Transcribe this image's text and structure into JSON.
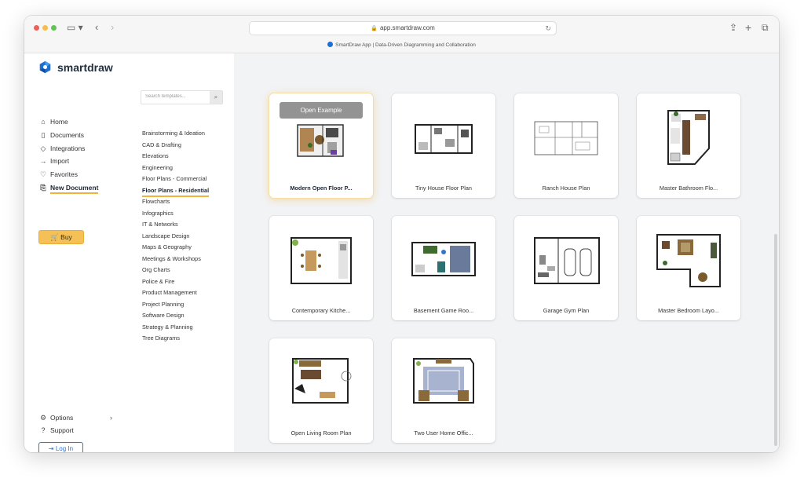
{
  "browser": {
    "url": "app.smartdraw.com",
    "tab_title": "SmartDraw App | Data-Driven Diagramming and Collaboration"
  },
  "brand": {
    "name": "smartdraw",
    "accent": "#f1b23a",
    "link": "#2f76d2"
  },
  "nav": {
    "items": [
      {
        "label": "Home",
        "icon": "home-icon"
      },
      {
        "label": "Documents",
        "icon": "document-icon"
      },
      {
        "label": "Integrations",
        "icon": "integrations-icon"
      },
      {
        "label": "Import",
        "icon": "import-icon"
      },
      {
        "label": "Favorites",
        "icon": "heart-icon"
      },
      {
        "label": "New Document",
        "icon": "new-document-icon",
        "active": true
      }
    ],
    "buy_label": "Buy",
    "options_label": "Options",
    "support_label": "Support",
    "login_label": "Log In"
  },
  "search": {
    "placeholder": "Search templates..."
  },
  "categories": [
    "Brainstorming & Ideation",
    "CAD & Drafting",
    "Elevations",
    "Engineering",
    "Floor Plans - Commercial",
    "Floor Plans - Residential",
    "Flowcharts",
    "Infographics",
    "IT & Networks",
    "Landscape Design",
    "Maps & Geography",
    "Meetings & Workshops",
    "Org Charts",
    "Police & Fire",
    "Product Management",
    "Project Planning",
    "Software Design",
    "Strategy & Planning",
    "Tree Diagrams"
  ],
  "active_category": "Floor Plans - Residential",
  "open_example_label": "Open Example",
  "templates": [
    {
      "name": "Modern Open Floor P...",
      "selected": true
    },
    {
      "name": "Tiny House Floor Plan"
    },
    {
      "name": "Ranch House Plan"
    },
    {
      "name": "Master Bathroom Flo..."
    },
    {
      "name": "Contemporary Kitche..."
    },
    {
      "name": "Basement Game Roo..."
    },
    {
      "name": "Garage Gym Plan"
    },
    {
      "name": "Master Bedroom Layo..."
    },
    {
      "name": "Open Living Room Plan"
    },
    {
      "name": "Two User Home Offic..."
    }
  ]
}
